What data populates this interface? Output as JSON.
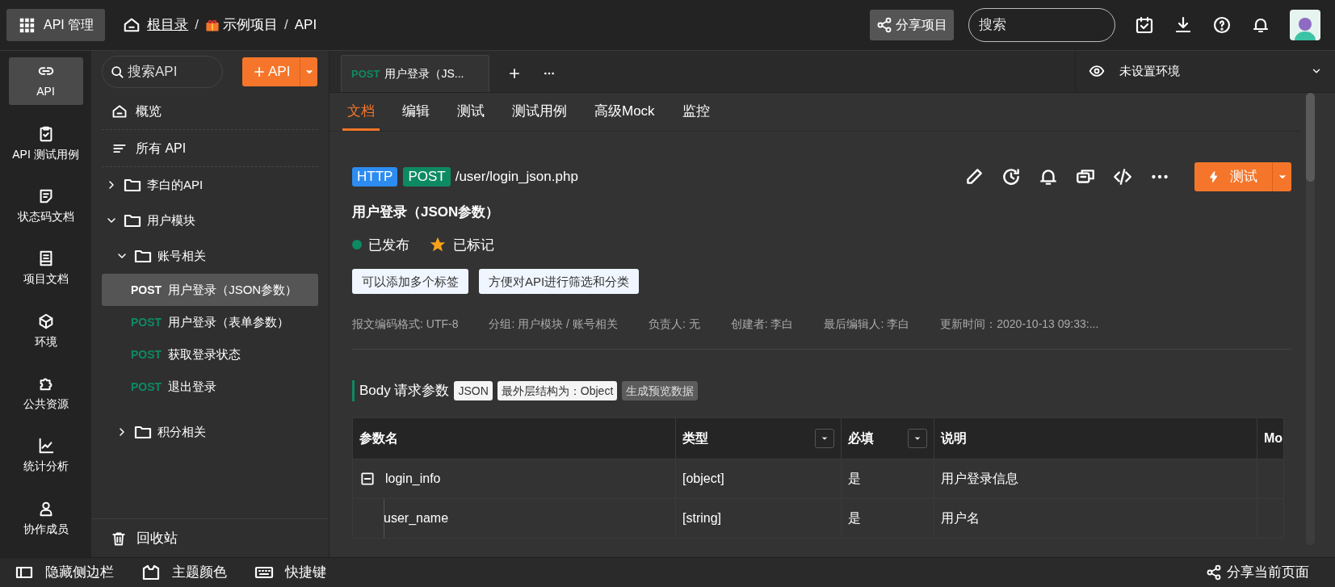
{
  "header": {
    "app_button": "API 管理",
    "breadcrumb": [
      {
        "kind": "home",
        "label": "根目录"
      },
      {
        "kind": "separator",
        "label": "/"
      },
      {
        "kind": "gift",
        "label": "示例项目"
      },
      {
        "kind": "separator",
        "label": "/"
      },
      {
        "kind": "plain",
        "label": "API"
      }
    ],
    "share_button": "分享项目",
    "search": {
      "placeholder": "搜索"
    }
  },
  "rail": [
    {
      "label": "API",
      "selected": true
    },
    {
      "label": "API 测试用例",
      "selected": false
    },
    {
      "label": "状态码文档",
      "selected": false
    },
    {
      "label": "项目文档",
      "selected": false
    },
    {
      "label": "环境",
      "selected": false
    },
    {
      "label": "公共资源",
      "selected": false
    },
    {
      "label": "统计分析",
      "selected": false
    },
    {
      "label": "协作成员",
      "selected": false
    }
  ],
  "tree": {
    "search": {
      "placeholder": "搜索API"
    },
    "add_button": "API",
    "items": [
      {
        "kind": "overview",
        "label": "概览",
        "selected": false
      },
      {
        "kind": "all",
        "label": "所有 API",
        "selected": false
      },
      {
        "kind": "folder",
        "label": "李白的API",
        "expanded": false
      },
      {
        "kind": "folder",
        "label": "用户模块",
        "expanded": true,
        "children": [
          {
            "kind": "folder",
            "label": "账号相关",
            "expanded": true,
            "children": [
              {
                "kind": "api",
                "method": "POST",
                "label": "用户登录（JSON参数）",
                "selected": true
              },
              {
                "kind": "api",
                "method": "POST",
                "label": "用户登录（表单参数）",
                "selected": false
              },
              {
                "kind": "api",
                "method": "POST",
                "label": "获取登录状态",
                "selected": false
              },
              {
                "kind": "api",
                "method": "POST",
                "label": "退出登录",
                "selected": false
              }
            ]
          },
          {
            "kind": "folder",
            "label": "积分相关",
            "expanded": false
          }
        ]
      }
    ],
    "trash": "回收站"
  },
  "open_tabs": [
    {
      "method": "POST",
      "title": "用户登录（JS...",
      "selected": true
    }
  ],
  "environment": "未设置环境",
  "doc_tabs": [
    {
      "label": "文档",
      "selected": true
    },
    {
      "label": "编辑",
      "selected": false
    },
    {
      "label": "测试",
      "selected": false
    },
    {
      "label": "测试用例",
      "selected": false
    },
    {
      "label": "高级Mock",
      "selected": false
    },
    {
      "label": "监控",
      "selected": false
    }
  ],
  "api": {
    "protocol": "HTTP",
    "method": "POST",
    "path": "/user/login_json.php",
    "title": "用户登录（JSON参数）",
    "status": {
      "label": "已发布",
      "color": "#0e8a63"
    },
    "starred": {
      "label": "已标记",
      "on": true
    },
    "test_button": "测试",
    "tags": [
      "可以添加多个标签",
      "方便对API进行筛选和分类"
    ],
    "meta": [
      "报文编码格式: UTF-8",
      "分组: 用户模块 / 账号相关",
      "负责人: 无",
      "创建者: 李白",
      "最后编辑人: 李白",
      "更新时间：2020-10-13 09:33:..."
    ]
  },
  "body_params": {
    "title": "Body 请求参数",
    "badges": [
      "JSON",
      "最外层结构为：Object"
    ],
    "preview_button": "生成预览数据",
    "table": {
      "columns": [
        {
          "label": "参数名",
          "filter": false
        },
        {
          "label": "类型",
          "filter": true
        },
        {
          "label": "必填",
          "filter": true
        },
        {
          "label": "说明",
          "filter": false
        },
        {
          "label": "Mo",
          "filter": false
        }
      ],
      "rows": [
        {
          "name": "login_info",
          "type": "[object]",
          "required": "是",
          "description": "用户登录信息",
          "expanded": true,
          "children": [
            {
              "name": "user_name",
              "type": "[string]",
              "required": "是",
              "description": "用户名"
            }
          ]
        }
      ]
    }
  },
  "bottom_bar": {
    "items": [
      "隐藏侧边栏",
      "主题颜色",
      "快捷键"
    ],
    "share": "分享当前页面"
  }
}
